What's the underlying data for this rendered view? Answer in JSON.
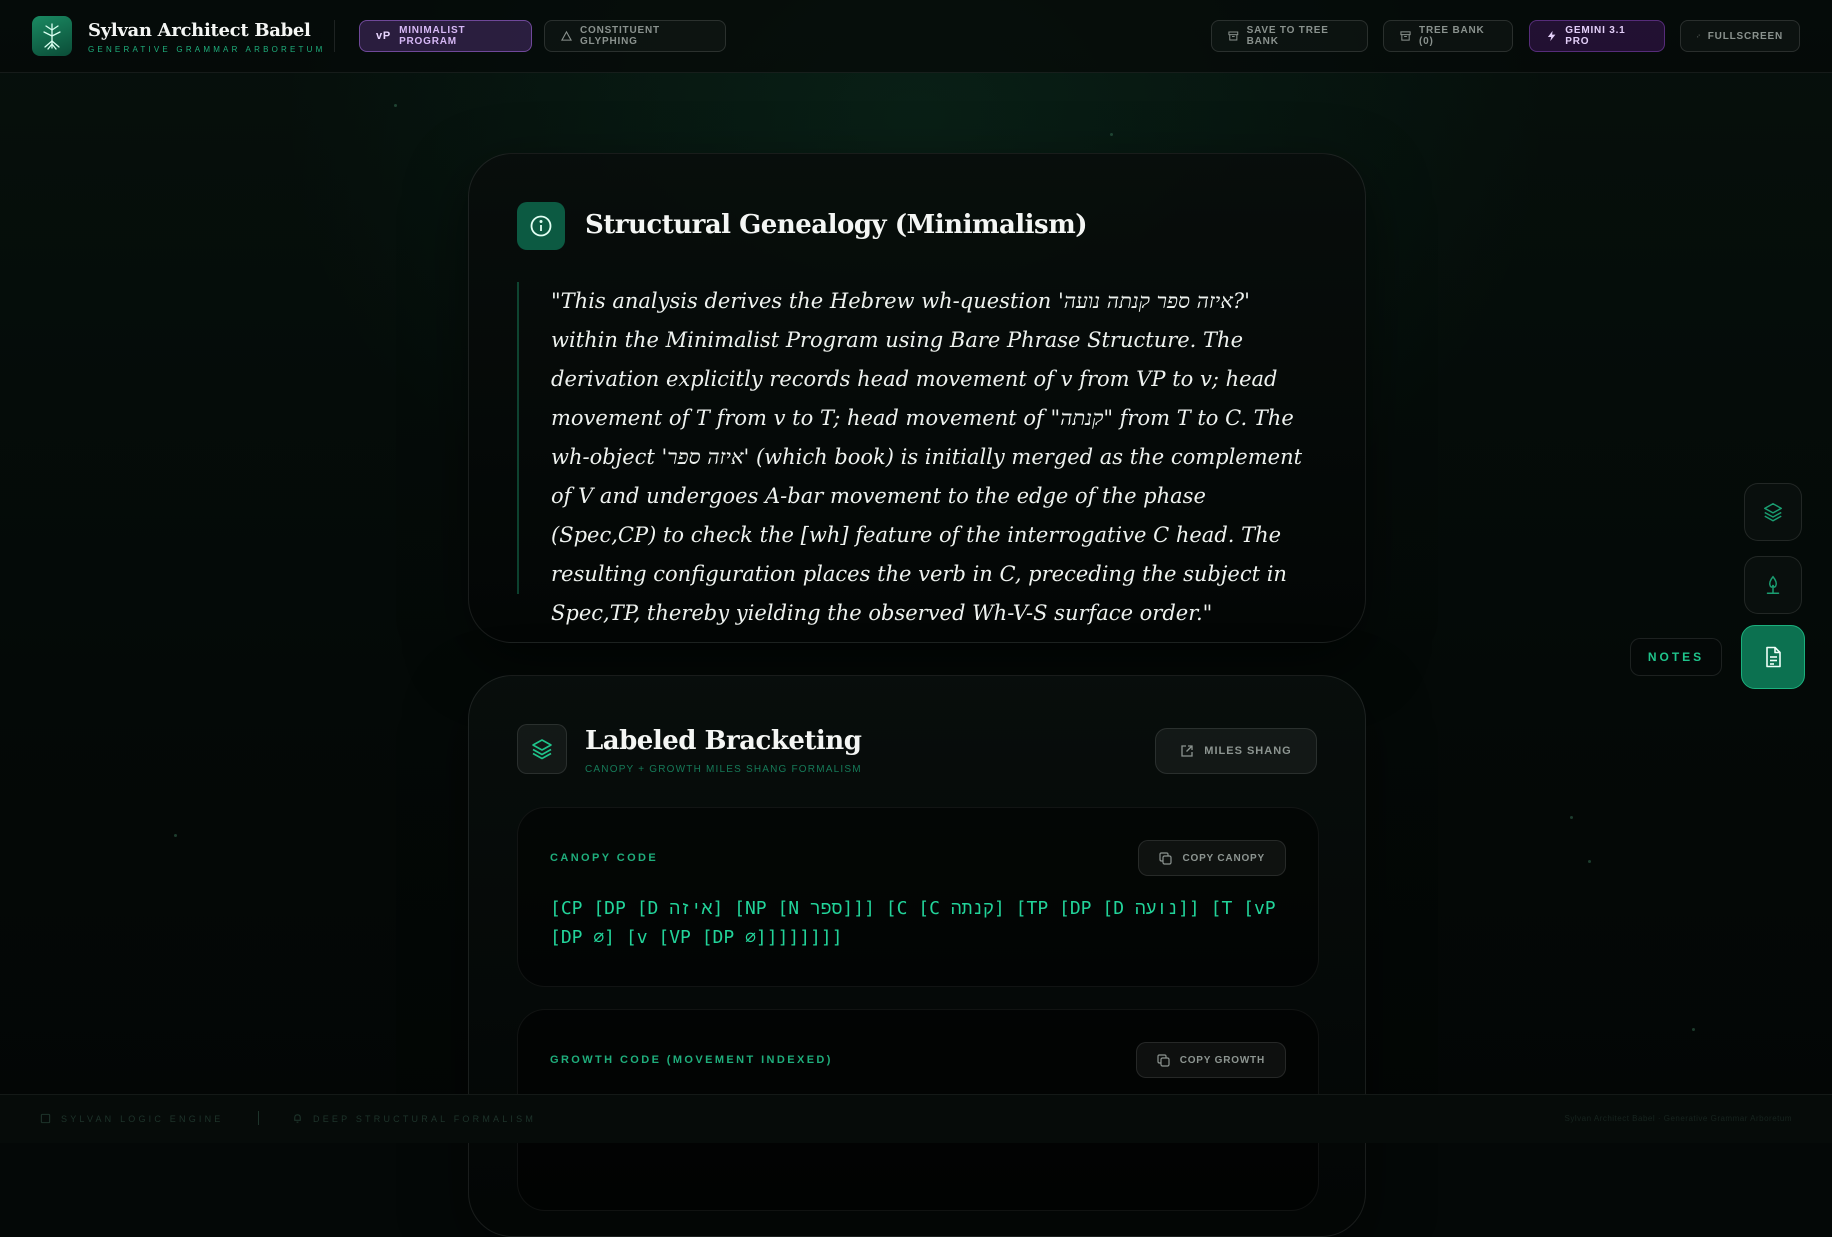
{
  "app": {
    "title": "Sylvan Architect Babel",
    "subtitle": "GENERATIVE GRAMMAR ARBORETUM"
  },
  "header": {
    "modes": [
      {
        "tag": "vP",
        "label": "MINIMALIST PROGRAM",
        "active": true
      },
      {
        "label": "CONSTITUENT GLYPHING",
        "active": false
      }
    ],
    "actions": {
      "save": "SAVE TO TREE BANK",
      "bank": "TREE BANK (0)",
      "model": "GEMINI 3.1 PRO",
      "fullscreen": "FULLSCREEN"
    }
  },
  "genealogy": {
    "title": "Structural Genealogy (Minimalism)",
    "text": "\"This analysis derives the Hebrew wh-question 'איזה ספר קנתה נועה?' within the Minimalist Program using Bare Phrase Structure. The derivation explicitly records head movement of v from VP to v; head movement of T from v to T; head movement of \"קנתה\" from T to C. The wh-object 'איזה ספר' (which book) is initially merged as the complement of V and undergoes A-bar movement to the edge of the phase (Spec,CP) to check the [wh] feature of the interrogative C head. The resulting configuration places the verb in C, preceding the subject in Spec,TP, thereby yielding the observed Wh-V-S surface order.\""
  },
  "bracketing": {
    "title": "Labeled Bracketing",
    "subtitle": "CANOPY + GROWTH MILES SHANG FORMALISM",
    "miles_button": "MILES SHANG",
    "canopy": {
      "label": "CANOPY CODE",
      "copy": "COPY CANOPY",
      "code": "[CP [DP [D איזה] [NP [N ספר]]] [C [C קנתה] [TP [DP [D נועה]] [T [vP [DP ∅] [v [VP [DP ∅]]]]]]]]"
    },
    "growth": {
      "label": "GROWTH CODE (MOVEMENT INDEXED)",
      "copy": "COPY GROWTH"
    }
  },
  "side_tools": {
    "tooltip": "NOTES",
    "items": [
      "layers-icon",
      "tree-icon",
      "document-icon"
    ]
  },
  "footer": {
    "left1": "SYLVAN LOGIC ENGINE",
    "left2": "DEEP STRUCTURAL FORMALISM",
    "right": "Sylvan Architect Babel · Generative Grammar Arboretum"
  },
  "colors": {
    "accent": "#1fae7c",
    "code": "#22d49a",
    "purple": "#d6b8f5",
    "background": "#040807"
  }
}
